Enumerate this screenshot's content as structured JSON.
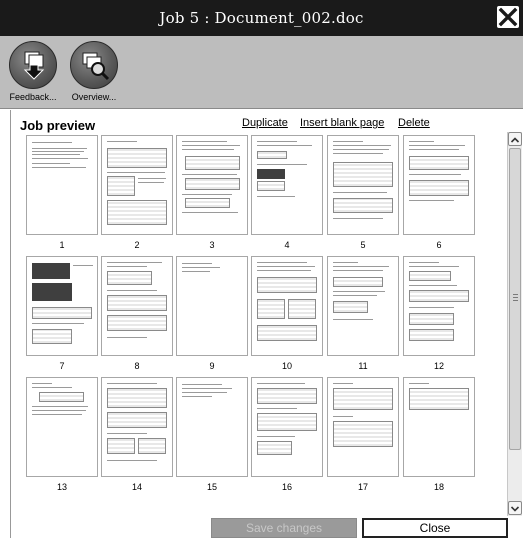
{
  "window": {
    "title": "Job 5 : Document_002.doc",
    "close_icon": "close-icon"
  },
  "toolbar": {
    "feedback_label": "Feedback...",
    "overview_label": "Overview..."
  },
  "preview": {
    "heading": "Job preview",
    "duplicate_label": "Duplicate",
    "insert_blank_label": "Insert blank page",
    "delete_label": "Delete",
    "pages": [
      "1",
      "2",
      "3",
      "4",
      "5",
      "6",
      "7",
      "8",
      "9",
      "10",
      "11",
      "12",
      "13",
      "14",
      "15",
      "16",
      "17",
      "18"
    ]
  },
  "footer": {
    "save_label": "Save changes",
    "close_label": "Close"
  }
}
